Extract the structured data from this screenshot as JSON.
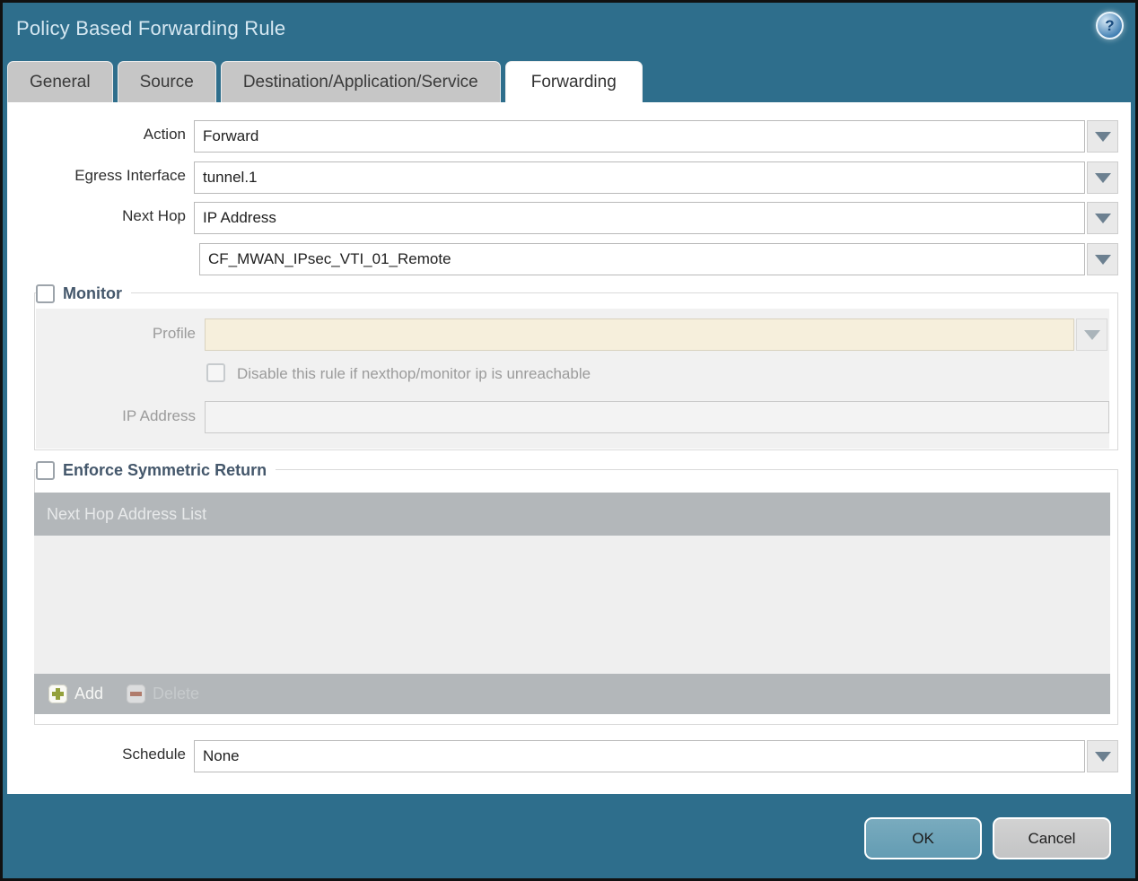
{
  "window": {
    "title": "Policy Based Forwarding Rule",
    "help_glyph": "?"
  },
  "tabs": {
    "general": "General",
    "source": "Source",
    "destination": "Destination/Application/Service",
    "forwarding": "Forwarding",
    "active_tab": "Forwarding"
  },
  "form": {
    "action_label": "Action",
    "action_value": "Forward",
    "egress_label": "Egress Interface",
    "egress_value": "tunnel.1",
    "next_hop_label": "Next Hop",
    "next_hop_value": "IP Address",
    "next_hop_address_value": "CF_MWAN_IPsec_VTI_01_Remote",
    "schedule_label": "Schedule",
    "schedule_value": "None"
  },
  "monitor": {
    "title": "Monitor",
    "checked": false,
    "profile_label": "Profile",
    "profile_value": "",
    "disable_label": "Disable this rule if nexthop/monitor ip is unreachable",
    "disable_checked": false,
    "ip_label": "IP Address",
    "ip_value": ""
  },
  "symmetric_return": {
    "title": "Enforce Symmetric Return",
    "checked": false,
    "table_header": "Next Hop Address List",
    "table_rows": [],
    "add_label": "Add",
    "delete_label": "Delete"
  },
  "footer": {
    "ok": "OK",
    "cancel": "Cancel"
  },
  "colors": {
    "frame_teal": "#2e6e8c",
    "tab_inactive": "#c6c6c6",
    "section_heading": "#44576b",
    "table_chrome": "#b3b7ba",
    "profile_field_bg": "#f6efdc",
    "ok_button": "#6da4ba",
    "cancel_button": "#c8c8c8",
    "add_plus_green": "#94a13c",
    "delete_minus_red": "#b07c6c"
  }
}
